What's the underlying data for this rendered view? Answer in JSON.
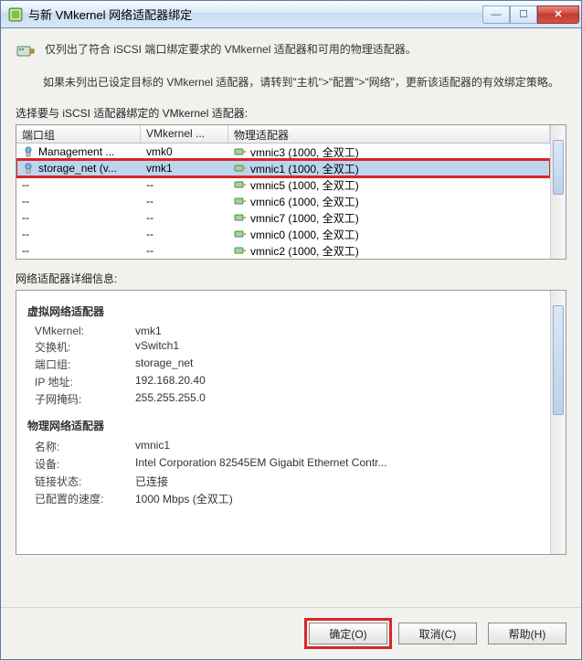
{
  "window": {
    "title": "与新 VMkernel 网络适配器绑定"
  },
  "info": {
    "line1": "仅列出了符合 iSCSI 端口绑定要求的 VMkernel 适配器和可用的物理适配器。",
    "policy": "如果未列出已设定目标的 VMkernel 适配器，请转到\"主机\">\"配置\">\"网络\"，更新该适配器的有效绑定策略。"
  },
  "table": {
    "prompt": "选择要与 iSCSI 适配器绑定的 VMkernel 适配器:",
    "headers": {
      "c1": "端口组",
      "c2": "VMkernel ...",
      "c3": "物理适配器"
    },
    "rows": [
      {
        "pg": "Management ...",
        "vmk": "vmk0",
        "phys": "vmnic3 (1000, 全双工)",
        "sel": false,
        "hl": false
      },
      {
        "pg": "storage_net (v...",
        "vmk": "vmk1",
        "phys": "vmnic1 (1000, 全双工)",
        "sel": true,
        "hl": true
      },
      {
        "pg": "--",
        "vmk": "--",
        "phys": "vmnic5 (1000, 全双工)",
        "sel": false,
        "hl": false
      },
      {
        "pg": "--",
        "vmk": "--",
        "phys": "vmnic6 (1000, 全双工)",
        "sel": false,
        "hl": false
      },
      {
        "pg": "--",
        "vmk": "--",
        "phys": "vmnic7 (1000, 全双工)",
        "sel": false,
        "hl": false
      },
      {
        "pg": "--",
        "vmk": "--",
        "phys": "vmnic0 (1000, 全双工)",
        "sel": false,
        "hl": false
      },
      {
        "pg": "--",
        "vmk": "--",
        "phys": "vmnic2 (1000, 全双工)",
        "sel": false,
        "hl": false
      }
    ]
  },
  "details": {
    "label": "网络适配器详细信息:",
    "virtual": {
      "title": "虚拟网络适配器",
      "vmkernel_k": "VMkernel:",
      "vmkernel_v": "vmk1",
      "vswitch_k": "交换机:",
      "vswitch_v": "vSwitch1",
      "pg_k": "端口组:",
      "pg_v": "storage_net",
      "ip_k": "IP 地址:",
      "ip_v": "192.168.20.40",
      "mask_k": "子网掩码:",
      "mask_v": "255.255.255.0"
    },
    "physical": {
      "title": "物理网络适配器",
      "name_k": "名称:",
      "name_v": "vmnic1",
      "device_k": "设备:",
      "device_v": "Intel Corporation 82545EM Gigabit Ethernet Contr...",
      "link_k": "链接状态:",
      "link_v": "已连接",
      "speed_k": "已配置的速度:",
      "speed_v": "1000 Mbps (全双工)"
    }
  },
  "buttons": {
    "ok": "确定(O)",
    "cancel": "取消(C)",
    "help": "帮助(H)"
  }
}
